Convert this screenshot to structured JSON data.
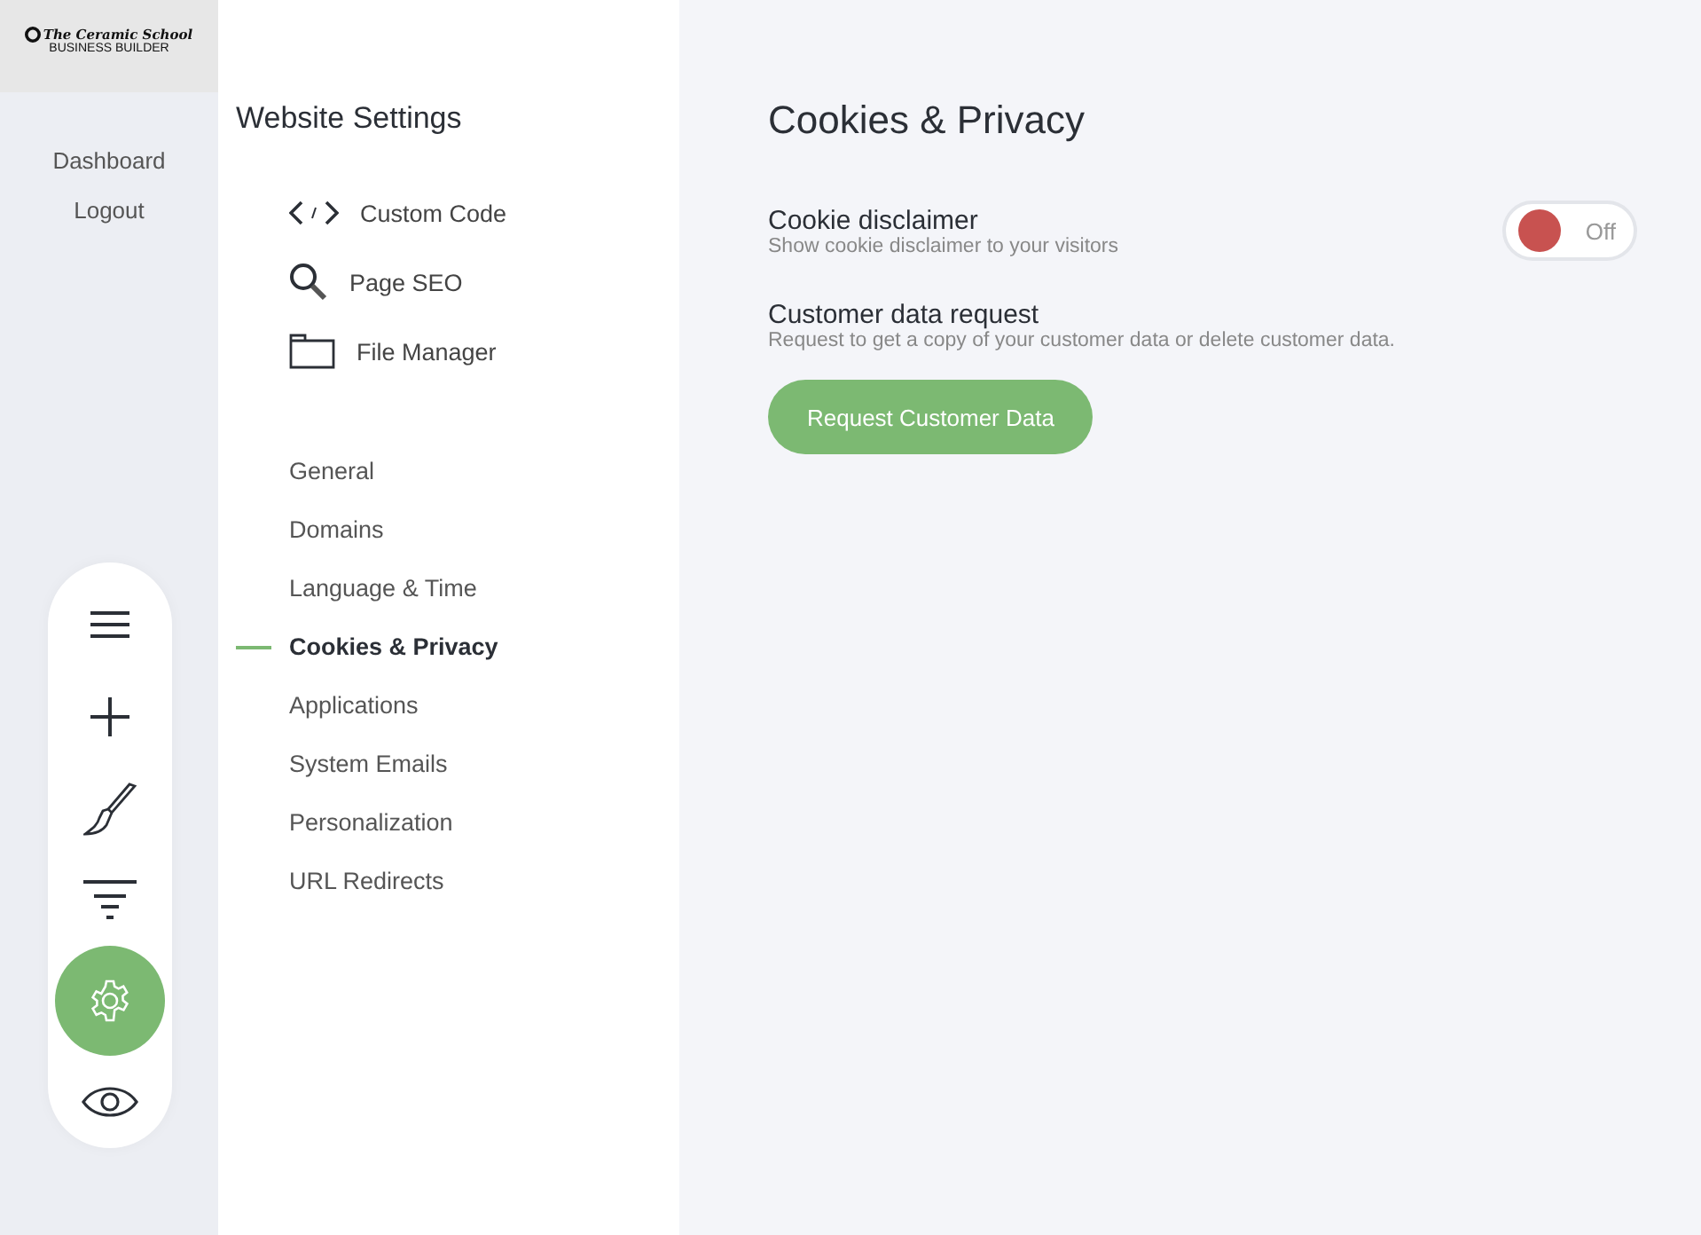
{
  "logo": {
    "script": "The Ceramic School",
    "caption": "BUSINESS BUILDER"
  },
  "rail_links": [
    "Dashboard",
    "Logout"
  ],
  "toolbar": [
    {
      "kind": "menu",
      "selected": false
    },
    {
      "kind": "add",
      "selected": false
    },
    {
      "kind": "brush",
      "selected": false
    },
    {
      "kind": "filter",
      "selected": false
    },
    {
      "kind": "settings",
      "selected": true
    },
    {
      "kind": "preview",
      "selected": false
    }
  ],
  "settings_panel": {
    "title": "Website Settings",
    "tools": [
      {
        "kind": "code",
        "label": "Custom Code"
      },
      {
        "kind": "search",
        "label": "Page SEO"
      },
      {
        "kind": "folder",
        "label": "File Manager"
      }
    ],
    "sections": [
      {
        "label": "General",
        "selected": false
      },
      {
        "label": "Domains",
        "selected": false
      },
      {
        "label": "Language & Time",
        "selected": false
      },
      {
        "label": "Cookies & Privacy",
        "selected": true
      },
      {
        "label": "Applications",
        "selected": false
      },
      {
        "label": "System Emails",
        "selected": false
      },
      {
        "label": "Personalization",
        "selected": false
      },
      {
        "label": "URL Redirects",
        "selected": false
      }
    ]
  },
  "page": {
    "title": "Cookies & Privacy",
    "cookie_disclaimer": {
      "label": "Cookie disclaimer",
      "description": "Show cookie disclaimer to your visitors",
      "on": false,
      "state_label": "Off"
    },
    "customer_data": {
      "label": "Customer data request",
      "description": "Request to get a copy of your customer data or delete customer data.",
      "button": "Request Customer Data"
    }
  }
}
